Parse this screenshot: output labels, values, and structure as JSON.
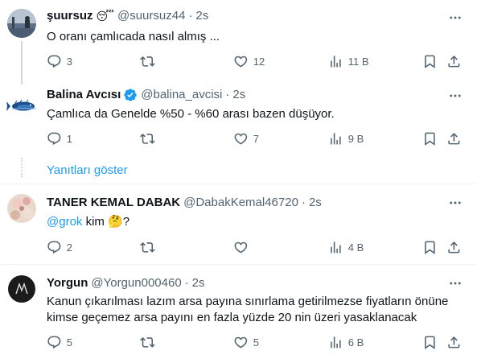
{
  "tweets": [
    {
      "name": "şuursuz",
      "emoji": "😴",
      "handle": "@suursuz44",
      "sep": "·",
      "time": "2s",
      "text": "O oranı çamlıcada nasıl almış ...",
      "counts": {
        "replies": "3",
        "retweets": "",
        "likes": "12",
        "views": "11 B"
      }
    },
    {
      "name": "Balina Avcısı",
      "handle": "@balina_avcisi",
      "sep": "·",
      "time": "2s",
      "text": "Çamlıca da Genelde %50 - %60 arası bazen düşüyor.",
      "counts": {
        "replies": "1",
        "retweets": "",
        "likes": "7",
        "views": "9 B"
      },
      "verified_color": "#1d9bf0"
    },
    {
      "name": "TANER KEMAL DABAK",
      "handle": "@DabakKemal46720",
      "sep": "·",
      "time": "2s",
      "mention": "@grok",
      "text_after": " kim 🤔?",
      "counts": {
        "replies": "2",
        "retweets": "",
        "likes": "",
        "views": "4 B"
      }
    },
    {
      "name": "Yorgun",
      "handle": "@Yorgun000460",
      "sep": "·",
      "time": "2s",
      "text_line1": "Kanun çıkarılması lazım arsa payına sınırlama getirilmezse fiyatların önüne",
      "text_line2": "kimse geçemez arsa payını en fazla yüzde 20 nin üzeri yasaklanacak",
      "counts": {
        "replies": "5",
        "retweets": "",
        "likes": "5",
        "views": "6 B"
      }
    }
  ],
  "show_replies_label": "Yanıtları göster",
  "icons": {
    "reply": "reply-icon",
    "retweet": "retweet-icon",
    "like": "heart-icon",
    "views": "views-icon",
    "bookmark": "bookmark-icon",
    "share": "share-icon",
    "more": "more-icon",
    "verified": "verified-badge-icon"
  },
  "colors": {
    "accent": "#1d9bf0",
    "secondary_text": "#536471",
    "divider": "#eff3f4"
  }
}
